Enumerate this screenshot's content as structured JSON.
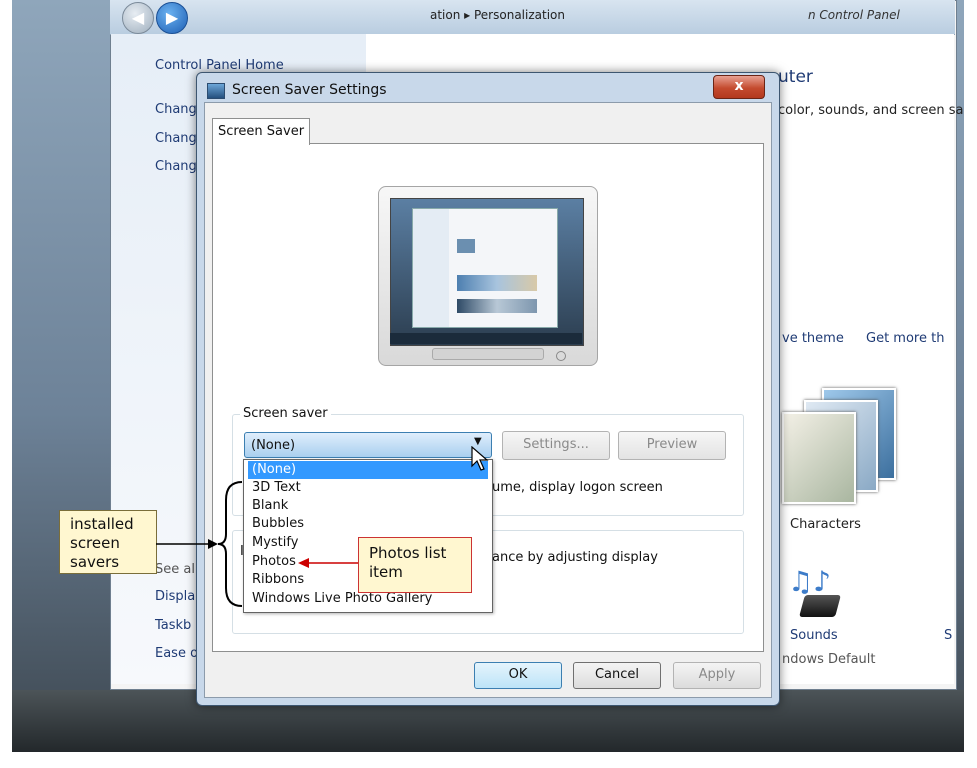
{
  "control_panel": {
    "breadcrumb": "ation  ▸  Personalization",
    "title_right": "n Control Panel",
    "left_links": {
      "home": "Control Panel Home",
      "change1": "Chang",
      "change2": "Chang",
      "change3": "Chang",
      "see_also": "See al",
      "display": "Displa",
      "taskbar": "Taskb",
      "ease": "Ease o"
    },
    "main_heading_frag": "uter",
    "main_desc_frag": "color, sounds, and screen sa",
    "save_theme_frag": "ve theme",
    "get_more_frag": "Get more th",
    "theme_name": "Characters",
    "sounds_label": "Sounds",
    "sounds_value": "ndows Default",
    "right_edge_frag": "S"
  },
  "dialog": {
    "title": "Screen Saver Settings",
    "close_label": "x",
    "tab_label": "Screen Saver",
    "group_label": "Screen saver",
    "combo_value": "(None)",
    "settings_label": "Settings...",
    "preview_label": "Preview",
    "logon_text": "ume, display logon screen",
    "power_text": "ance by adjusting display",
    "power_group_frag": "I",
    "dropdown_items": [
      "(None)",
      "3D Text",
      "Blank",
      "Bubbles",
      "Mystify",
      "Photos",
      "Ribbons",
      "Windows Live Photo Gallery"
    ],
    "selected_item": "(None)",
    "ok_label": "OK",
    "cancel_label": "Cancel",
    "apply_label": "Apply"
  },
  "callouts": {
    "left_line1": "installed",
    "left_line2": "screen",
    "left_line3": "savers",
    "right_line1": "Photos list",
    "right_line2": "item"
  },
  "colors": {
    "selection": "#3399ff",
    "callout_bg": "#fff7d0",
    "callout_border_right": "#cc3333",
    "link": "#1f3b75",
    "arrow": "#cc0000"
  }
}
